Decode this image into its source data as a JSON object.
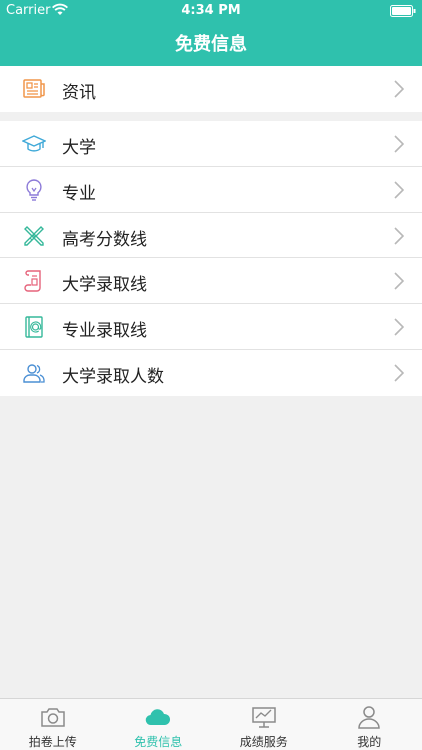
{
  "status": {
    "carrier": "Carrier",
    "time": "4:34 PM"
  },
  "nav": {
    "title": "免费信息"
  },
  "groups": [
    {
      "items": [
        {
          "label": "资讯",
          "icon": "newspaper-icon"
        }
      ]
    },
    {
      "items": [
        {
          "label": "大学",
          "icon": "graduation-cap-icon"
        },
        {
          "label": "专业",
          "icon": "lightbulb-icon"
        },
        {
          "label": "高考分数线",
          "icon": "pencil-ruler-icon"
        },
        {
          "label": "大学录取线",
          "icon": "scroll-icon"
        },
        {
          "label": "专业录取线",
          "icon": "address-book-icon"
        },
        {
          "label": "大学录取人数",
          "icon": "users-icon"
        }
      ]
    }
  ],
  "tabbar": {
    "tabs": [
      {
        "label": "拍卷上传",
        "icon": "camera-icon",
        "active": false
      },
      {
        "label": "免费信息",
        "icon": "cloud-icon",
        "active": true
      },
      {
        "label": "成绩服务",
        "icon": "chart-board-icon",
        "active": false
      },
      {
        "label": "我的",
        "icon": "person-icon",
        "active": false
      }
    ]
  },
  "colors": {
    "accent": "#2fc1ad",
    "background": "#f0f0f0"
  }
}
